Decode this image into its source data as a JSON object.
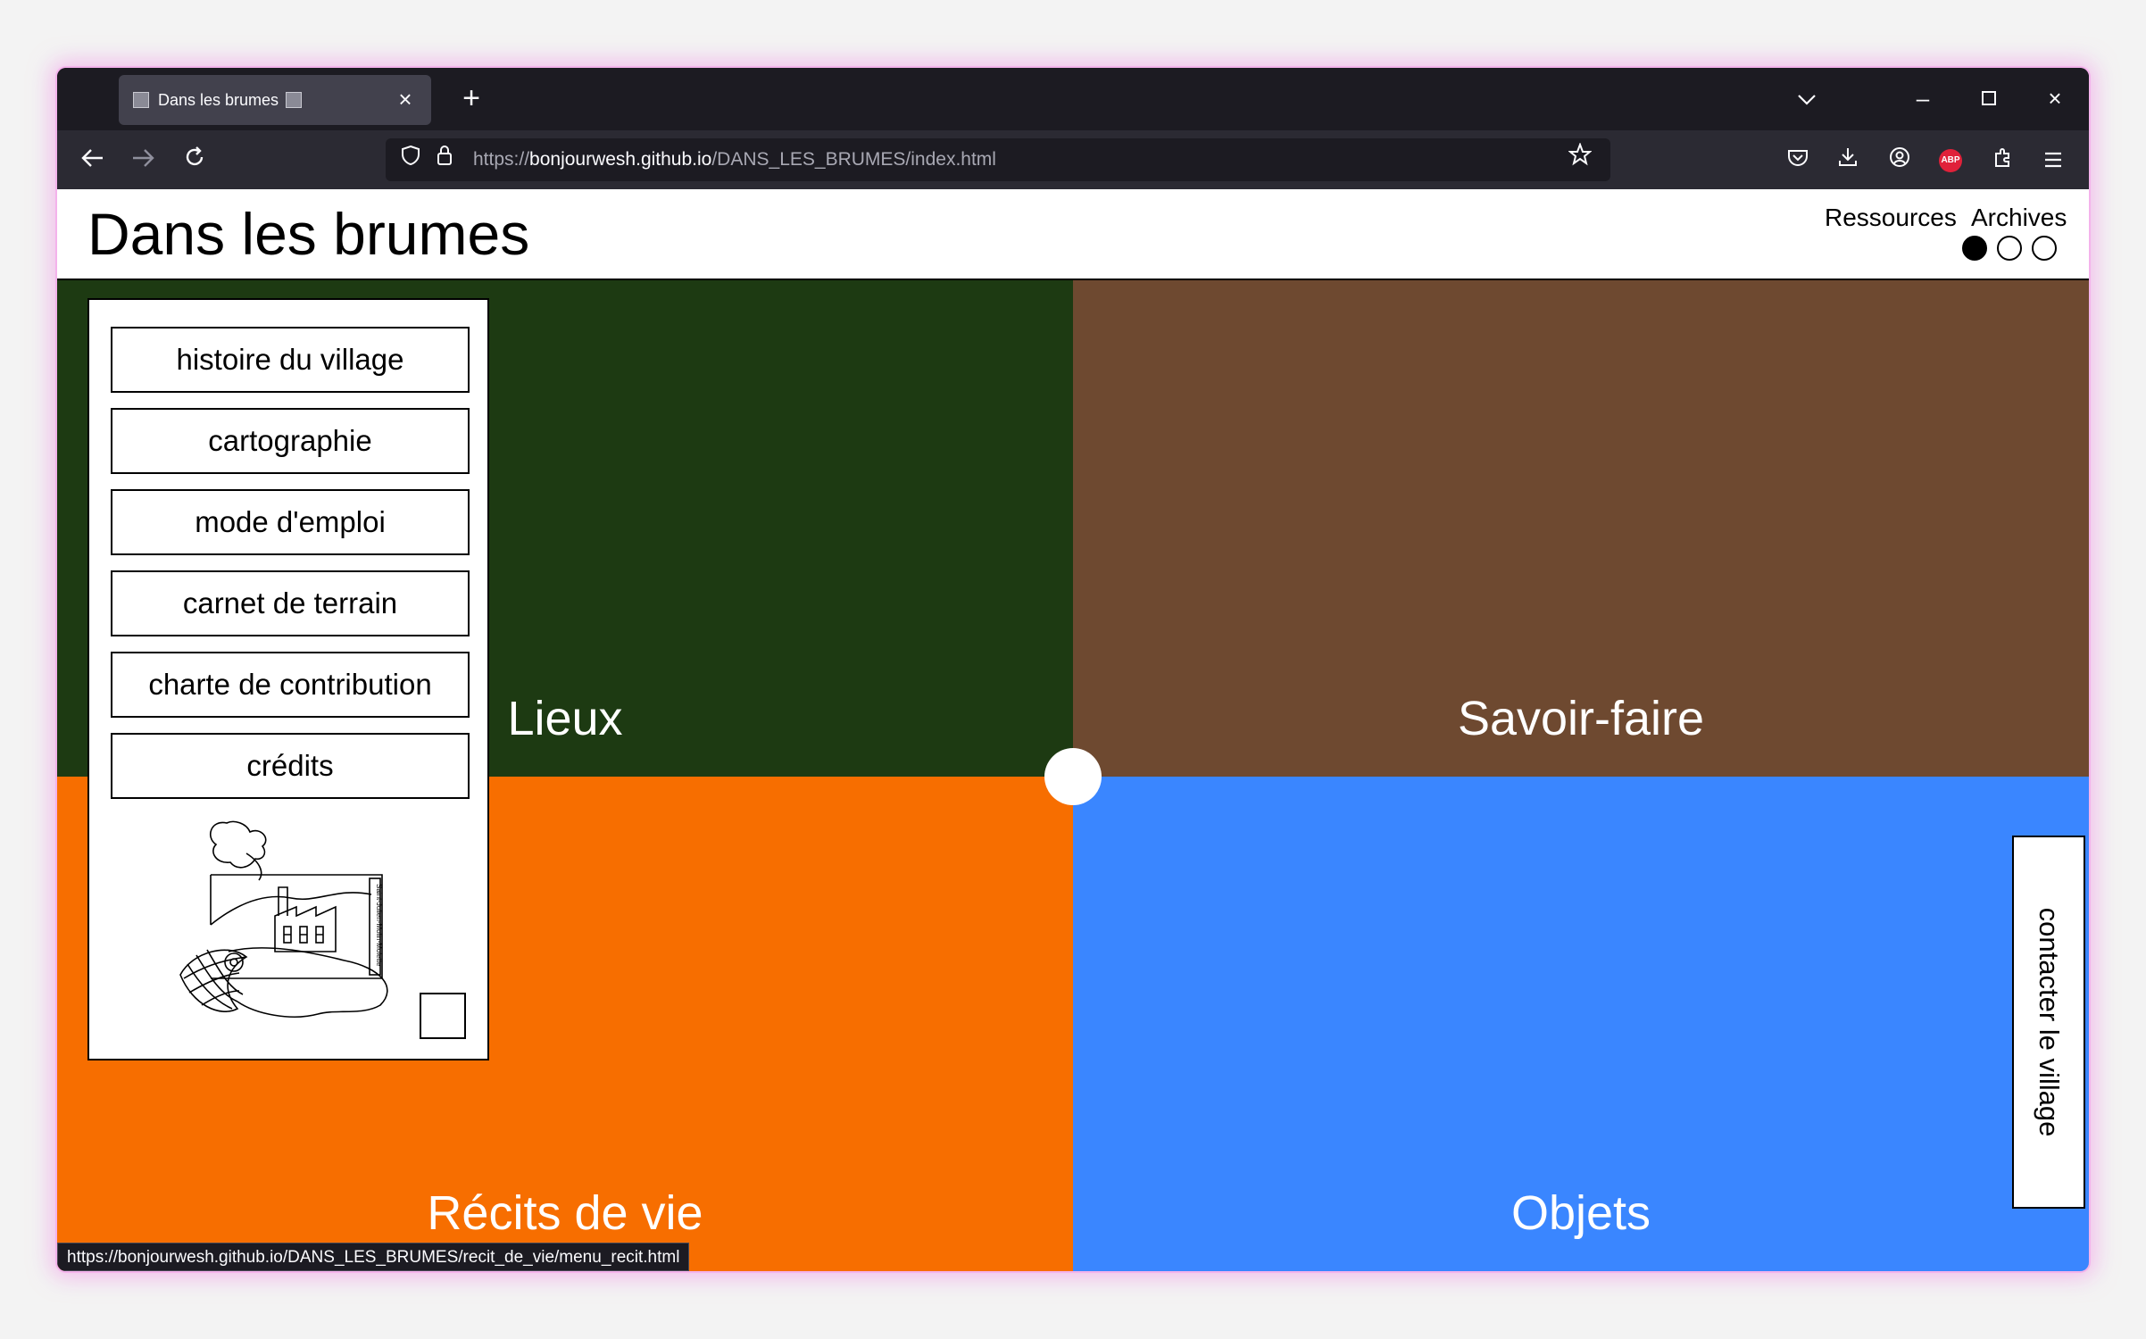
{
  "browser": {
    "tab_title": "Dans les brumes",
    "url": {
      "proto": "https://",
      "host": "bonjourwesh.github.io",
      "path": "/DANS_LES_BRUMES/index.html"
    },
    "status_url": "https://bonjourwesh.github.io/DANS_LES_BRUMES/recit_de_vie/menu_recit.html"
  },
  "header": {
    "title": "Dans les brumes",
    "links": [
      "Ressources",
      "Archives"
    ]
  },
  "menu": {
    "items": [
      "histoire du village",
      "cartographie",
      "mode d'emploi",
      "carnet de terrain",
      "charte de contribution",
      "crédits"
    ],
    "illustration_text": "Saint-Julien-Molin-Molette"
  },
  "quadrants": {
    "top_left": "Lieux",
    "top_right": "Savoir-faire",
    "bottom_left": "Récits de vie",
    "bottom_right": "Objets"
  },
  "contact_label": "contacter le village",
  "colors": {
    "lieux": "#1d3a12",
    "savoir_faire": "#6e4930",
    "recits": "#f76e00",
    "objets": "#3a86ff"
  }
}
